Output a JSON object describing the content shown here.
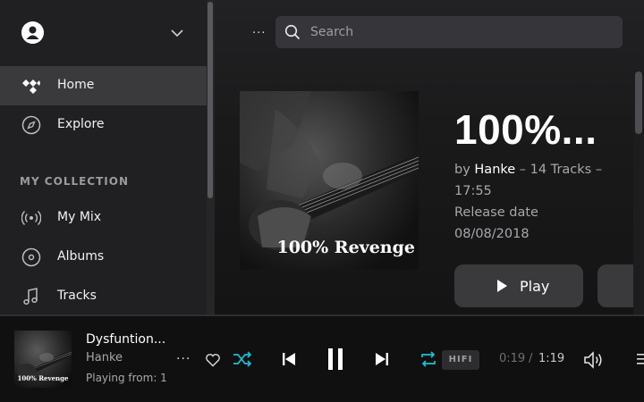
{
  "sidebar": {
    "nav": [
      {
        "label": "Home",
        "icon": "tidal-logo-icon",
        "active": true
      },
      {
        "label": "Explore",
        "icon": "compass-icon",
        "active": false
      }
    ],
    "section_title": "MY COLLECTION",
    "collection": [
      {
        "label": "My Mix",
        "icon": "radio-waves-icon"
      },
      {
        "label": "Albums",
        "icon": "disc-icon"
      },
      {
        "label": "Tracks",
        "icon": "music-note-icon"
      }
    ]
  },
  "header": {
    "dots": "...",
    "search_placeholder": "Search"
  },
  "album": {
    "cover_text": "100% Revenge",
    "title": "100%...",
    "by_prefix": "by",
    "artist": "Hanke",
    "tracks_text": "– 14 Tracks –",
    "duration": "17:55",
    "release_label": "Release date",
    "release_date": "08/08/2018",
    "play_label": "Play"
  },
  "player": {
    "thumb_text": "100% Revenge",
    "title": "Dysfuntion...",
    "artist": "Hanke",
    "playing_from": "Playing from:  1",
    "more": "...",
    "quality_badge": "HIFI",
    "elapsed": "0:19",
    "separator": "/",
    "total": "1:19",
    "accent_color": "#17c3d6"
  }
}
